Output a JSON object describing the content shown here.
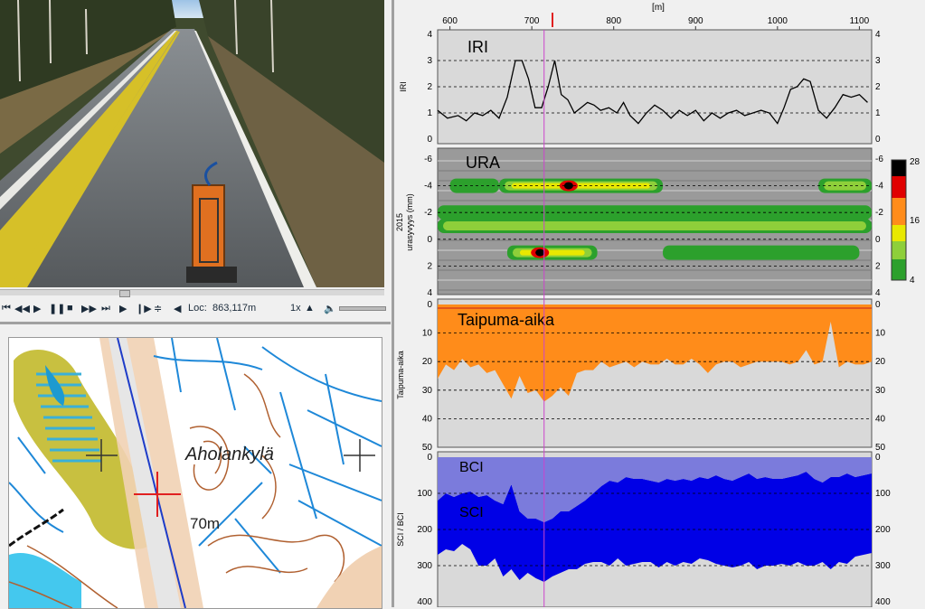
{
  "player": {
    "loc_label": "Loc:",
    "loc_value": "863,117m",
    "speed": "1x"
  },
  "map": {
    "place_name": "Aholankylä",
    "distance_label": "70m"
  },
  "xaxis": {
    "unit_label": "[m]",
    "ticks": [
      "600",
      "700",
      "800",
      "900",
      "1000",
      "1100"
    ],
    "tick_values": [
      600,
      700,
      800,
      900,
      1000,
      1100
    ],
    "range": [
      585,
      1115
    ],
    "cursor_x": 715
  },
  "panels": {
    "iri": {
      "name": "IRI",
      "ylabel": "IRI",
      "ticks": [
        "4",
        "3",
        "2",
        "1",
        "0"
      ]
    },
    "ura": {
      "name": "URA",
      "ylabel_year": "2015",
      "ylabel": "urasyvyys (mm)",
      "ticks": [
        "-6",
        "-4",
        "-2",
        "0",
        "2",
        "4"
      ],
      "legend_ticks": [
        "28",
        "16",
        "4"
      ]
    },
    "taipuma": {
      "name": "Taipuma-aika",
      "ylabel": "Taipuma-aika",
      "ticks": [
        "0",
        "10",
        "20",
        "30",
        "40",
        "50"
      ]
    },
    "bci": {
      "name_top": "BCI",
      "name_bottom": "SCI",
      "ylabel": "SCI / BCI",
      "ticks": [
        "0",
        "100",
        "200",
        "300",
        "400"
      ]
    }
  },
  "colors": {
    "panel_bg": "#d9d9d9",
    "line": "#000000",
    "cursor": "#cc44cc",
    "taipuma_fill": "#ff8c1a",
    "bci_fill": "#7b7bdc",
    "sci_fill": "#0000e6",
    "ura_bg": "#9a9a9a",
    "ura_green": "#2ca02c",
    "ura_yellow": "#e8e800",
    "ura_red": "#e00000"
  },
  "chart_data": [
    {
      "type": "line",
      "title": "IRI",
      "ylabel": "IRI",
      "xlabel": "[m]",
      "ylim": [
        0,
        4
      ],
      "xlim": [
        585,
        1115
      ],
      "x": [
        585,
        597,
        610,
        620,
        630,
        640,
        650,
        660,
        670,
        680,
        688,
        696,
        704,
        712,
        720,
        728,
        736,
        744,
        752,
        760,
        768,
        776,
        784,
        794,
        804,
        812,
        820,
        830,
        840,
        850,
        860,
        870,
        880,
        890,
        900,
        910,
        920,
        930,
        940,
        950,
        960,
        970,
        980,
        990,
        1000,
        1008,
        1016,
        1024,
        1032,
        1040,
        1050,
        1060,
        1070,
        1080,
        1090,
        1100,
        1110
      ],
      "values": [
        1.1,
        0.8,
        0.9,
        0.7,
        1.0,
        0.9,
        1.1,
        0.8,
        1.6,
        3.0,
        3.0,
        2.3,
        1.2,
        1.2,
        2.0,
        3.0,
        1.7,
        1.5,
        1.0,
        1.2,
        1.4,
        1.3,
        1.1,
        1.2,
        1.0,
        1.4,
        0.9,
        0.6,
        1.0,
        1.3,
        1.1,
        0.8,
        1.1,
        0.9,
        1.1,
        0.7,
        1.0,
        0.8,
        1.0,
        1.1,
        0.9,
        1.0,
        1.1,
        1.0,
        0.6,
        1.2,
        1.9,
        2.0,
        2.3,
        2.2,
        1.1,
        0.8,
        1.2,
        1.7,
        1.6,
        1.7,
        1.4
      ]
    },
    {
      "type": "heatmap",
      "title": "URA",
      "ylabel": "urasyvyys (mm)",
      "xlabel": "[m]",
      "ylim": [
        -6,
        4
      ],
      "xlim": [
        585,
        1115
      ],
      "colorbar": [
        4,
        16,
        28
      ],
      "bands": [
        {
          "y": -4,
          "segments": [
            [
              660,
              860,
              16
            ],
            [
              1050,
              1115,
              12
            ],
            [
              600,
              660,
              5
            ]
          ],
          "peak": {
            "x": 745,
            "value": 28
          }
        },
        {
          "y": -2,
          "segments": [
            [
              585,
              1115,
              6
            ]
          ]
        },
        {
          "y": -1,
          "segments": [
            [
              585,
              1115,
              10
            ]
          ]
        },
        {
          "y": 1,
          "segments": [
            [
              670,
              780,
              16
            ],
            [
              860,
              1100,
              8
            ]
          ],
          "peak": {
            "x": 710,
            "value": 28
          }
        }
      ]
    },
    {
      "type": "area",
      "title": "Taipuma-aika",
      "ylabel": "Taipuma-aika",
      "xlabel": "[m]",
      "ylim": [
        0,
        50
      ],
      "xlim": [
        585,
        1115
      ],
      "x": [
        585,
        595,
        605,
        615,
        625,
        635,
        645,
        655,
        665,
        675,
        685,
        695,
        705,
        715,
        725,
        735,
        745,
        755,
        765,
        775,
        785,
        795,
        805,
        815,
        825,
        835,
        845,
        855,
        865,
        875,
        885,
        895,
        905,
        915,
        925,
        935,
        945,
        955,
        965,
        975,
        985,
        995,
        1005,
        1015,
        1025,
        1035,
        1045,
        1055,
        1065,
        1075,
        1085,
        1095,
        1105,
        1115
      ],
      "values": [
        26,
        21,
        23,
        19,
        22,
        21,
        24,
        23,
        28,
        33,
        25,
        31,
        30,
        34,
        32,
        29,
        32,
        24,
        23,
        23,
        20,
        22,
        21,
        20,
        22,
        20,
        21,
        21,
        19,
        21,
        21,
        19,
        21,
        24,
        21,
        20,
        20,
        22,
        21,
        20,
        20,
        20,
        20,
        21,
        20,
        16,
        21,
        20,
        6,
        22,
        20,
        21,
        21,
        20
      ]
    },
    {
      "type": "area",
      "title": "BCI / SCI",
      "ylabel": "SCI / BCI",
      "xlabel": "[m]",
      "ylim": [
        0,
        400
      ],
      "xlim": [
        585,
        1115
      ],
      "series": [
        {
          "name": "BCI",
          "x": [
            585,
            595,
            605,
            615,
            625,
            635,
            645,
            655,
            665,
            675,
            685,
            695,
            705,
            715,
            725,
            735,
            745,
            755,
            765,
            775,
            785,
            795,
            805,
            815,
            825,
            835,
            845,
            855,
            865,
            875,
            885,
            895,
            905,
            915,
            925,
            935,
            945,
            955,
            965,
            975,
            985,
            995,
            1005,
            1015,
            1025,
            1035,
            1045,
            1055,
            1065,
            1075,
            1085,
            1095,
            1105,
            1115
          ],
          "values": [
            120,
            100,
            110,
            100,
            95,
            110,
            105,
            120,
            130,
            75,
            150,
            170,
            170,
            180,
            170,
            150,
            150,
            135,
            120,
            100,
            80,
            65,
            70,
            55,
            60,
            60,
            65,
            70,
            60,
            65,
            60,
            65,
            55,
            60,
            50,
            60,
            65,
            55,
            45,
            60,
            55,
            60,
            60,
            55,
            50,
            40,
            60,
            70,
            55,
            55,
            45,
            55,
            50,
            45
          ]
        },
        {
          "name": "SCI",
          "x": [
            585,
            595,
            605,
            615,
            625,
            635,
            645,
            655,
            665,
            675,
            685,
            695,
            705,
            715,
            725,
            735,
            745,
            755,
            765,
            775,
            785,
            795,
            805,
            815,
            825,
            835,
            845,
            855,
            865,
            875,
            885,
            895,
            905,
            915,
            925,
            935,
            945,
            955,
            965,
            975,
            985,
            995,
            1005,
            1015,
            1025,
            1035,
            1045,
            1055,
            1065,
            1075,
            1085,
            1095,
            1105,
            1115
          ],
          "values": [
            270,
            255,
            260,
            240,
            255,
            300,
            300,
            280,
            330,
            310,
            340,
            320,
            335,
            345,
            330,
            320,
            310,
            310,
            295,
            290,
            290,
            300,
            280,
            300,
            295,
            290,
            290,
            305,
            290,
            300,
            290,
            295,
            280,
            285,
            295,
            300,
            305,
            300,
            290,
            310,
            300,
            300,
            295,
            300,
            290,
            300,
            300,
            290,
            310,
            290,
            295,
            275,
            270,
            265
          ]
        }
      ]
    }
  ]
}
